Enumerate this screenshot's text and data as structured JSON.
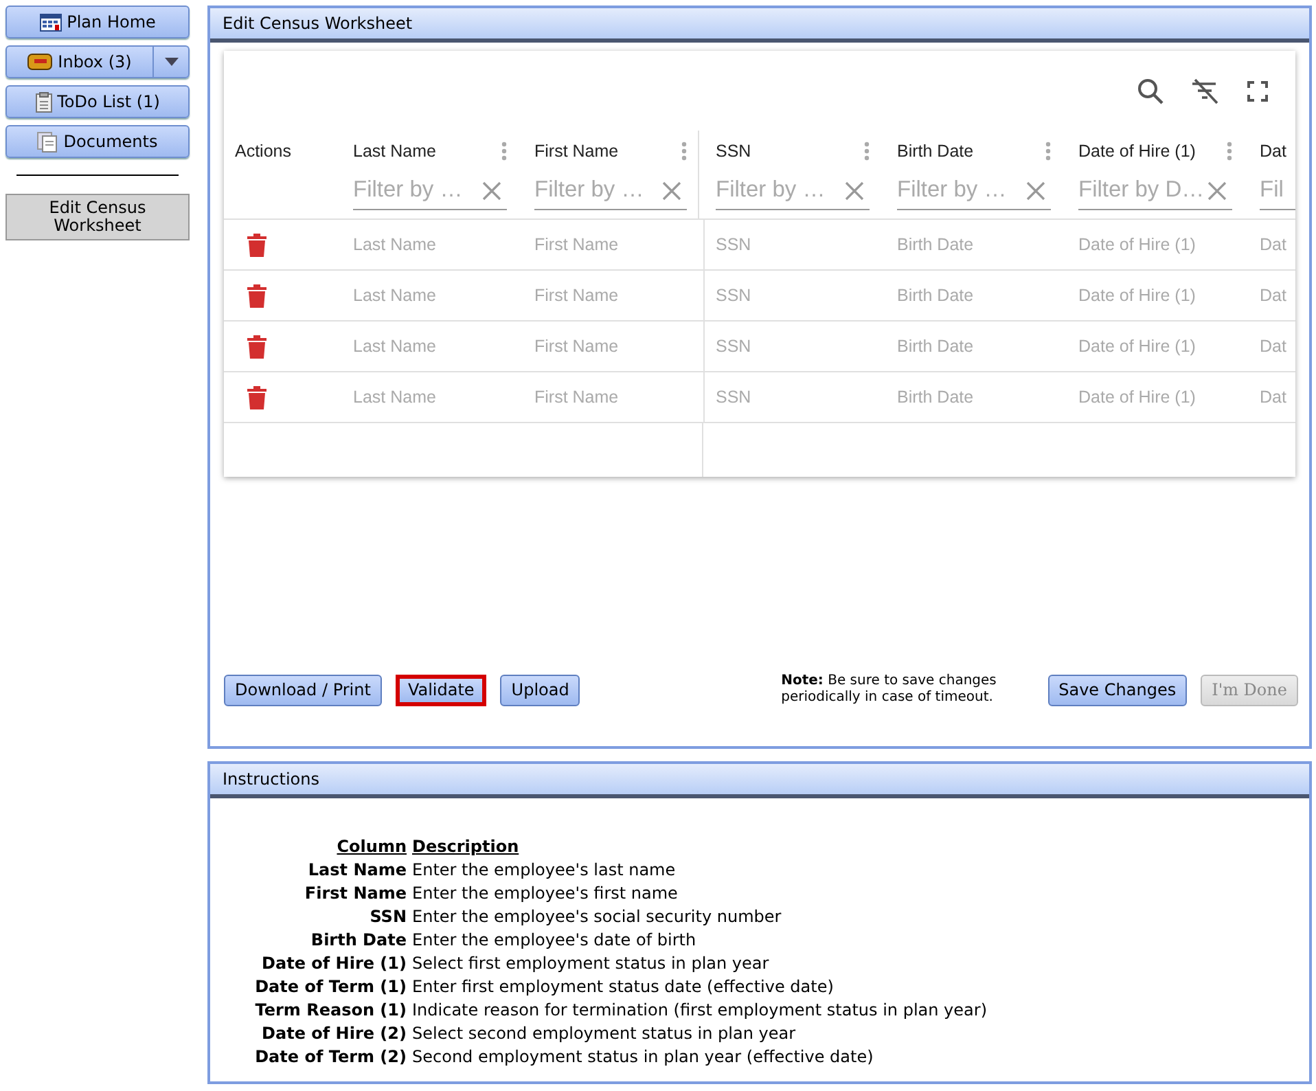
{
  "sidebar": {
    "items": [
      {
        "label": "Plan Home",
        "selected": false,
        "has_dropdown": false
      },
      {
        "label": "Inbox (3)",
        "selected": false,
        "has_dropdown": true
      },
      {
        "label": "ToDo List (1)",
        "selected": false,
        "has_dropdown": false
      },
      {
        "label": "Documents",
        "selected": false,
        "has_dropdown": false
      },
      {
        "label": "Edit Census Worksheet",
        "selected": true,
        "has_dropdown": false
      }
    ]
  },
  "worksheet_panel": {
    "title": "Edit Census Worksheet",
    "grid": {
      "actions_heading": "Actions",
      "columns": [
        {
          "label": "Last Name",
          "filter_placeholder": "Filter by …"
        },
        {
          "label": "First Name",
          "filter_placeholder": "Filter by …"
        },
        {
          "label": "SSN",
          "filter_placeholder": "Filter by …"
        },
        {
          "label": "Birth Date",
          "filter_placeholder": "Filter by …"
        },
        {
          "label": "Date of Hire (1)",
          "filter_placeholder": "Filter by D…"
        },
        {
          "label": "Dat",
          "filter_placeholder": "Fil"
        }
      ],
      "rows": [
        {
          "cells": [
            "Last Name",
            "First Name",
            "SSN",
            "Birth Date",
            "Date of Hire (1)",
            "Dat"
          ]
        },
        {
          "cells": [
            "Last Name",
            "First Name",
            "SSN",
            "Birth Date",
            "Date of Hire (1)",
            "Dat"
          ]
        },
        {
          "cells": [
            "Last Name",
            "First Name",
            "SSN",
            "Birth Date",
            "Date of Hire (1)",
            "Dat"
          ]
        },
        {
          "cells": [
            "Last Name",
            "First Name",
            "SSN",
            "Birth Date",
            "Date of Hire (1)",
            "Dat"
          ]
        }
      ]
    },
    "buttons_left": [
      {
        "label": "Download / Print",
        "focused": false,
        "disabled": false
      },
      {
        "label": "Validate",
        "focused": true,
        "disabled": false
      },
      {
        "label": "Upload",
        "focused": false,
        "disabled": false
      }
    ],
    "note": "**Note:** Be sure to save changes periodically in case of timeout.",
    "buttons_right": [
      {
        "label": "Save Changes",
        "focused": false,
        "disabled": false
      },
      {
        "label": "I'm Done",
        "focused": false,
        "disabled": true
      }
    ]
  },
  "instructions_panel": {
    "title": "Instructions",
    "column_heading": "Column",
    "description_heading": "Description",
    "rows": [
      {
        "column": "Last Name",
        "description": "Enter the employee's last name"
      },
      {
        "column": "First Name",
        "description": "Enter the employee's first name"
      },
      {
        "column": "SSN",
        "description": "Enter the employee's social security number"
      },
      {
        "column": "Birth Date",
        "description": "Enter the employee's date of birth"
      },
      {
        "column": "Date of Hire (1)",
        "description": "Select first employment status in plan year"
      },
      {
        "column": "Date of Term (1)",
        "description": "Enter first employment status date (effective date)"
      },
      {
        "column": "Term Reason (1)",
        "description": "Indicate reason for termination (first employment status in plan year)"
      },
      {
        "column": "Date of Hire (2)",
        "description": "Select second employment status in plan year"
      },
      {
        "column": "Date of Term (2)",
        "description": "Second employment status in plan year (effective date)"
      }
    ]
  }
}
